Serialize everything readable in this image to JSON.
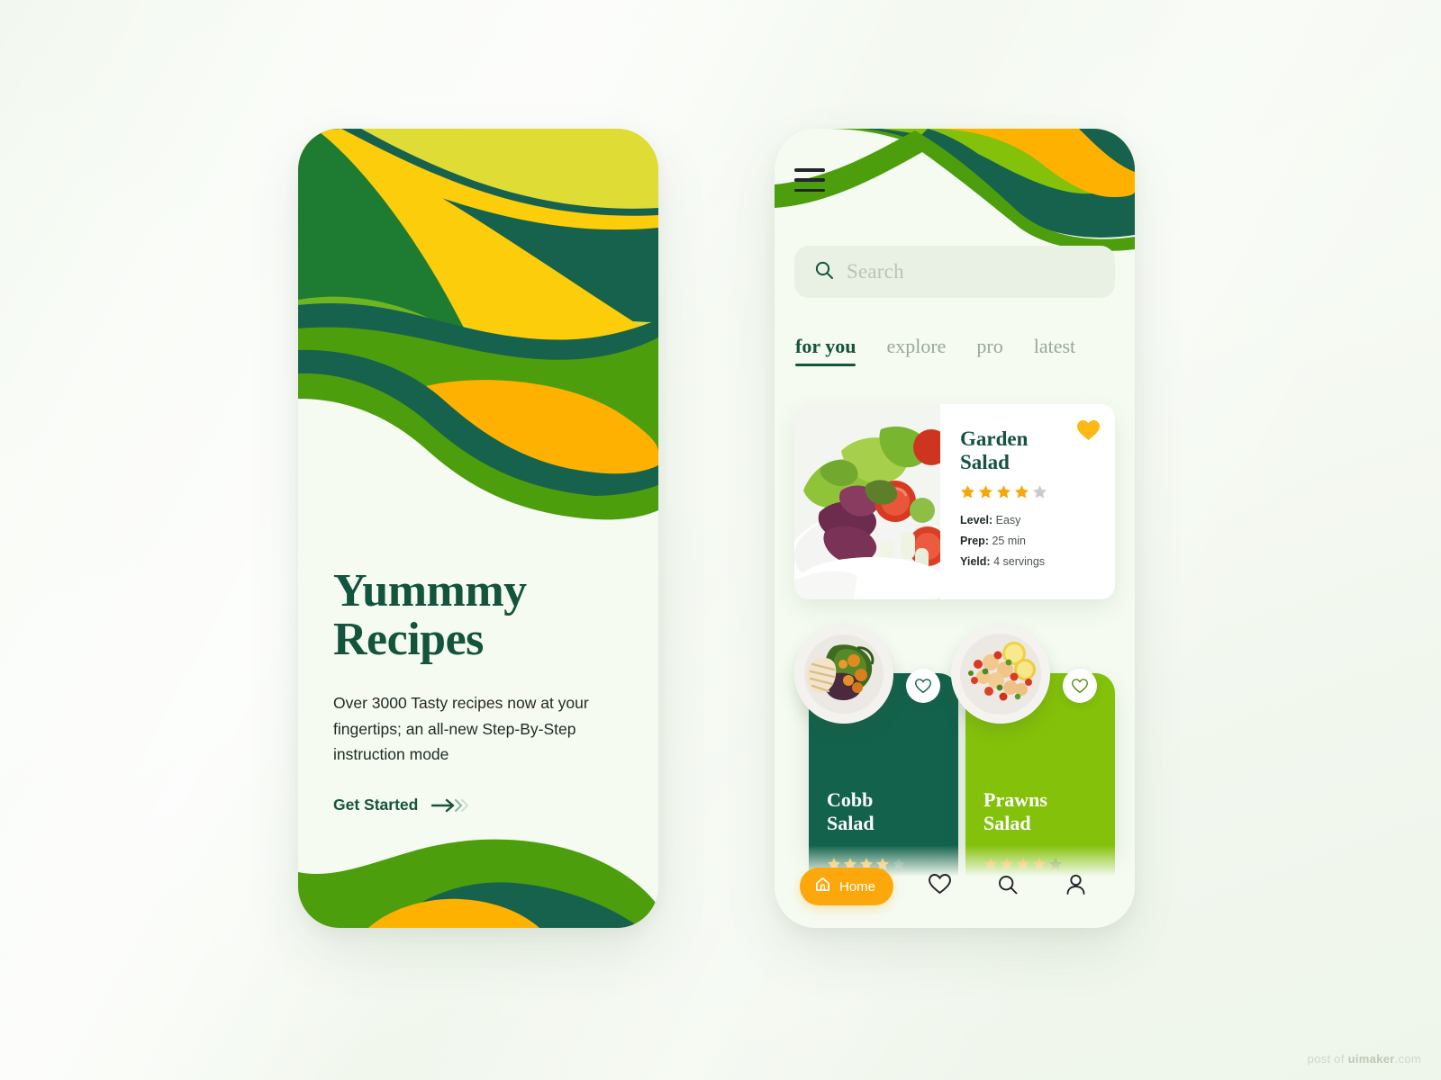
{
  "palette": {
    "page_bg": "#f4f9f1",
    "phone_bg": "#f5fbf1",
    "dark_green": "#14543c",
    "teal_green": "#13624c",
    "mid_green": "#1e7b32",
    "grass_green": "#4c9e0d",
    "lime_green": "#84c10a",
    "yellow_green": "#dfdc36",
    "yellow": "#fbcd0a",
    "orange": "#ffb100",
    "accent_orange": "#fca80d",
    "star_orange": "#f7a70a",
    "star_muted": "#bfc7bf"
  },
  "onboarding": {
    "title_line1": "Yummmy",
    "title_line2": "Recipes",
    "subtitle": "Over 3000 Tasty recipes now at your fingertips; an all-new Step-By-Step instruction mode",
    "cta_label": "Get Started",
    "cta_icon": "arrow-right-icon"
  },
  "home": {
    "menu_icon": "hamburger-menu-icon",
    "search": {
      "icon": "search-icon",
      "placeholder": "Search",
      "value": ""
    },
    "tabs": [
      {
        "label": "for you",
        "active": true
      },
      {
        "label": "explore",
        "active": false
      },
      {
        "label": "pro",
        "active": false
      },
      {
        "label": "latest",
        "active": false
      }
    ],
    "feature_card": {
      "title_line1": "Garden",
      "title_line2": "Salad",
      "photo": "garden-salad-photo",
      "favorite_icon": "heart-filled-icon",
      "favorited": true,
      "rating": 4,
      "rating_max": 5,
      "meta": [
        {
          "label": "Level:",
          "value": "Easy"
        },
        {
          "label": "Prep:",
          "value": "25 min"
        },
        {
          "label": "Yield:",
          "value": "4 servings"
        }
      ]
    },
    "small_cards": [
      {
        "title_line1": "Cobb",
        "title_line2": "Salad",
        "rating": 4,
        "rating_max": 5,
        "favorite_icon": "heart-outline-icon",
        "photo": "cobb-salad-photo"
      },
      {
        "title_line1": "Prawns",
        "title_line2": "Salad",
        "rating": 4,
        "rating_max": 5,
        "favorite_icon": "heart-outline-icon",
        "photo": "prawns-salad-photo"
      }
    ],
    "bottom_nav": [
      {
        "label": "Home",
        "icon": "home-icon",
        "active": true
      },
      {
        "label": "",
        "icon": "heart-outline-icon",
        "active": false
      },
      {
        "label": "",
        "icon": "search-icon",
        "active": false
      },
      {
        "label": "",
        "icon": "person-icon",
        "active": false
      }
    ]
  },
  "watermark": {
    "prefix": "post of ",
    "brand": "uimaker",
    "suffix": ".com"
  }
}
